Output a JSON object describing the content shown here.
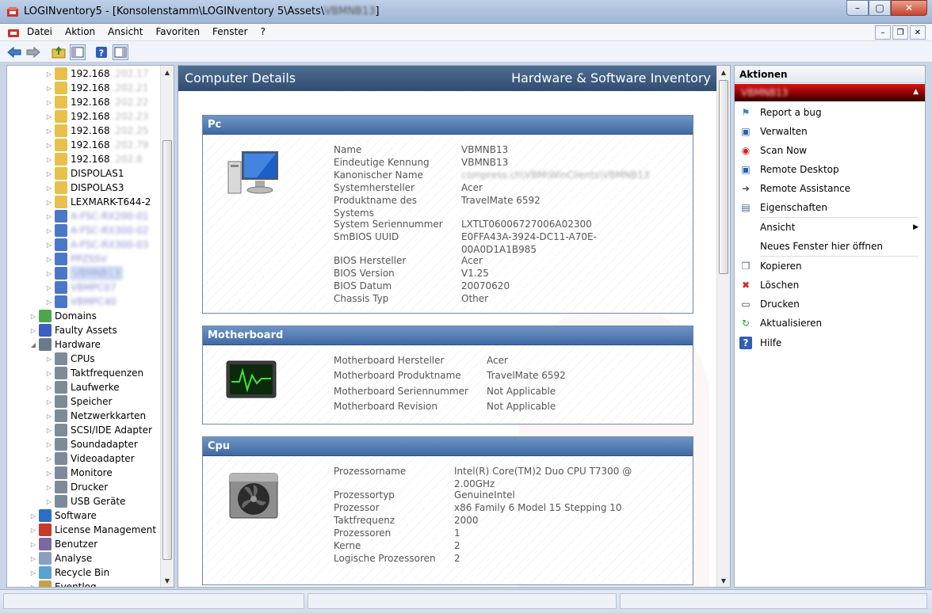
{
  "window": {
    "title_prefix": "LOGINventory5 - [Konsolenstamm\\LOGINventory 5\\Assets\\",
    "title_blurred": "VBMNB13",
    "title_suffix": "]",
    "close_label": "✕",
    "max_label": "▢",
    "min_label": "–"
  },
  "menubar": {
    "items": [
      {
        "label": "Datei",
        "accel": "D"
      },
      {
        "label": "Aktion",
        "accel": "k"
      },
      {
        "label": "Ansicht",
        "accel": "A"
      },
      {
        "label": "Favoriten",
        "accel": "F"
      },
      {
        "label": "Fenster",
        "accel": "F"
      },
      {
        "label": "?",
        "accel": "?"
      }
    ]
  },
  "tree": {
    "ip_rows": [
      {
        "prefix": "192.168",
        "suffix": ".202.17"
      },
      {
        "prefix": "192.168",
        "suffix": ".202.21"
      },
      {
        "prefix": "192.168",
        "suffix": ".202.22"
      },
      {
        "prefix": "192.168",
        "suffix": ".202.23"
      },
      {
        "prefix": "192.168",
        "suffix": ".202.25"
      },
      {
        "prefix": "192.168",
        "suffix": ".202.79"
      },
      {
        "prefix": "192.168",
        "suffix": ".202.8"
      }
    ],
    "named_rows": [
      "DISPOLAS1",
      "DISPOLAS3",
      "LEXMARK-T644-2"
    ],
    "blurred_rows": [
      "A-FSC-RX200-01",
      "A-FSC-RX300-02",
      "A-FSC-RX300-03",
      "PPZSSV",
      "VBMNB13",
      "VBMPC07",
      "VBMPC40"
    ],
    "top_items": [
      "Domains",
      "Faulty Assets",
      "Hardware"
    ],
    "hardware_children": [
      "CPUs",
      "Taktfrequenzen",
      "Laufwerke",
      "Speicher",
      "Netzwerkkarten",
      "SCSI/IDE Adapter",
      "Soundadapter",
      "Videoadapter",
      "Monitore",
      "Drucker",
      "USB Geräte"
    ],
    "bottom_items": [
      "Software",
      "License Management",
      "Benutzer",
      "Analyse",
      "Recycle Bin",
      "Eventlog"
    ]
  },
  "center": {
    "header_left": "Computer Details",
    "header_right": "Hardware & Software Inventory",
    "panels": {
      "pc": {
        "title": "Pc",
        "rows": [
          {
            "k": "Name",
            "v": "VBMNB13"
          },
          {
            "k": "Eindeutige Kennung",
            "v": "VBMNB13"
          },
          {
            "k": "Kanonischer Name",
            "v": "compress.ch\\VBM\\WinClients\\VBMNB13"
          },
          {
            "k": "Systemhersteller",
            "v": "Acer"
          },
          {
            "k": "Produktname des Systems",
            "v": "TravelMate 6592"
          },
          {
            "k": "System Seriennummer",
            "v": "LXTLT06006727006A02300"
          },
          {
            "k": "SmBIOS UUID",
            "v": "E0FFA43A-3924-DC11-A70E-00A0D1A1B985"
          },
          {
            "k": "BIOS Hersteller",
            "v": "Acer"
          },
          {
            "k": "BIOS Version",
            "v": "V1.25"
          },
          {
            "k": "BIOS Datum",
            "v": "20070620"
          },
          {
            "k": "Chassis Typ",
            "v": "Other"
          }
        ]
      },
      "motherboard": {
        "title": "Motherboard",
        "rows": [
          {
            "k": "Motherboard Hersteller",
            "v": "Acer"
          },
          {
            "k": "Motherboard Produktname",
            "v": "TravelMate 6592"
          },
          {
            "k": "Motherboard Seriennummer",
            "v": "Not Applicable"
          },
          {
            "k": "Motherboard Revision",
            "v": "Not Applicable"
          }
        ]
      },
      "cpu": {
        "title": "Cpu",
        "rows": [
          {
            "k": "Prozessorname",
            "v": "Intel(R) Core(TM)2 Duo CPU T7300 @ 2.00GHz"
          },
          {
            "k": "Prozessortyp",
            "v": "GenuineIntel"
          },
          {
            "k": "Prozessor",
            "v": "x86 Family 6 Model 15 Stepping 10"
          },
          {
            "k": "Taktfrequenz",
            "v": "2000"
          },
          {
            "k": "Prozessoren",
            "v": "1"
          },
          {
            "k": "Kerne",
            "v": "2"
          },
          {
            "k": "Logische Prozessoren",
            "v": "2"
          }
        ]
      }
    }
  },
  "actions": {
    "header": "Aktionen",
    "selected": "VBMNB13",
    "items": [
      {
        "label": "Report a bug",
        "icon": "windows-flag-icon"
      },
      {
        "label": "Verwalten",
        "icon": "computer-manage-icon"
      },
      {
        "label": "Scan Now",
        "icon": "scan-icon"
      },
      {
        "label": "Remote Desktop",
        "icon": "remote-desktop-icon"
      },
      {
        "label": "Remote Assistance",
        "icon": "remote-assistance-icon"
      },
      {
        "label": "Eigenschaften",
        "icon": "properties-icon"
      },
      {
        "label": "Ansicht",
        "icon": ""
      },
      {
        "label": "Neues Fenster hier öffnen",
        "icon": ""
      },
      {
        "label": "Kopieren",
        "icon": "copy-icon"
      },
      {
        "label": "Löschen",
        "icon": "delete-icon"
      },
      {
        "label": "Drucken",
        "icon": "print-icon"
      },
      {
        "label": "Aktualisieren",
        "icon": "refresh-icon"
      },
      {
        "label": "Hilfe",
        "icon": "help-icon"
      }
    ]
  }
}
